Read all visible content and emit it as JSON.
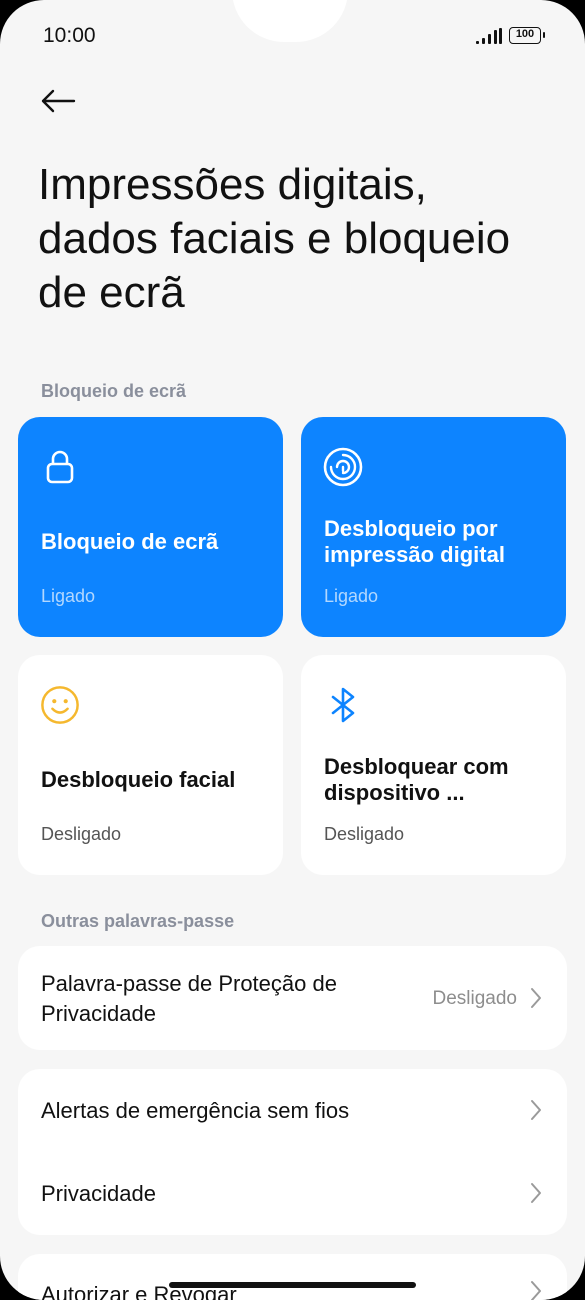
{
  "status_bar": {
    "time": "10:00",
    "battery": "100",
    "signal_icon": "signal-bars-icon"
  },
  "header": {
    "back_icon": "arrow-left-icon",
    "title": "Impressões digitais, dados faciais e bloqueio de ecrã"
  },
  "sections": {
    "screen_lock": "Bloqueio de ecrã",
    "other_passwords": "Outras palavras-passe"
  },
  "tiles": [
    {
      "title": "Bloqueio de ecrã",
      "status": "Ligado",
      "icon": "padlock-icon",
      "active": true
    },
    {
      "title": "Desbloqueio por impressão digital",
      "status": "Ligado",
      "icon": "fingerprint-icon",
      "active": true
    },
    {
      "title": "Desbloqueio facial",
      "status": "Desligado",
      "icon": "smiley-face-icon",
      "active": false
    },
    {
      "title": "Desbloquear com dispositivo ...",
      "status": "Desligado",
      "icon": "bluetooth-icon",
      "active": false
    }
  ],
  "rows": {
    "privacy_password": {
      "label": "Palavra-passe de Proteção de Privacidade",
      "value": "Desligado"
    },
    "emergency_alerts": {
      "label": "Alertas de emergência sem fios"
    },
    "privacy": {
      "label": "Privacidade"
    },
    "authorize_revoke": {
      "label": "Autorizar e Revogar"
    }
  },
  "colors": {
    "accent": "#0d84ff",
    "background": "#f6f6f6",
    "face_icon": "#f5b82e",
    "section_header": "#8a8f9c"
  }
}
